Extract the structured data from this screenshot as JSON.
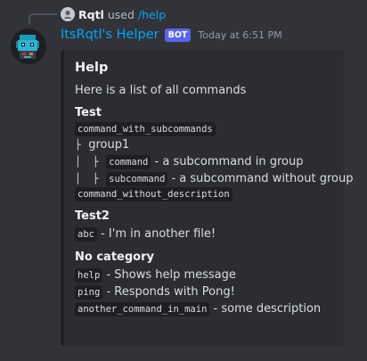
{
  "reply": {
    "username": "Rqtl",
    "verb": "used",
    "command": "/help"
  },
  "message": {
    "username": "ItsRqtl's Helper",
    "bot_tag": "BOT",
    "timestamp": "Today at 6:51 PM"
  },
  "embed": {
    "title": "Help",
    "description": "Here is a list of all commands",
    "fields": [
      {
        "name": "Test",
        "lines": [
          {
            "prefix": "",
            "code": "command_with_subcommands",
            "text": ""
          },
          {
            "prefix": "├ ",
            "code": "",
            "text": "group1"
          },
          {
            "prefix": "│  ├ ",
            "code": "command",
            "text": "- a subcommand in group"
          },
          {
            "prefix": "│  ├ ",
            "code": "subcommand",
            "text": "- a subcommand without group"
          },
          {
            "prefix": "",
            "code": "command_without_description",
            "text": ""
          }
        ]
      },
      {
        "name": "Test2",
        "lines": [
          {
            "prefix": "",
            "code": "abc",
            "text": "- I'm in another file!"
          }
        ]
      },
      {
        "name": "No category",
        "lines": [
          {
            "prefix": "",
            "code": "help",
            "text": "- Shows help message"
          },
          {
            "prefix": "",
            "code": "ping",
            "text": "- Responds with Pong!"
          },
          {
            "prefix": "",
            "code": "another_command_in_main",
            "text": "- some description"
          }
        ]
      }
    ]
  },
  "colors": {
    "background": "#313338",
    "embed_background": "#2b2d31",
    "username": "#00a8fc",
    "bot_tag": "#5865f2",
    "command_link": "#00a8fc"
  },
  "icons": {
    "reply_avatar": "user-avatar-icon",
    "bot_avatar": "pixel-robot-avatar-icon"
  }
}
